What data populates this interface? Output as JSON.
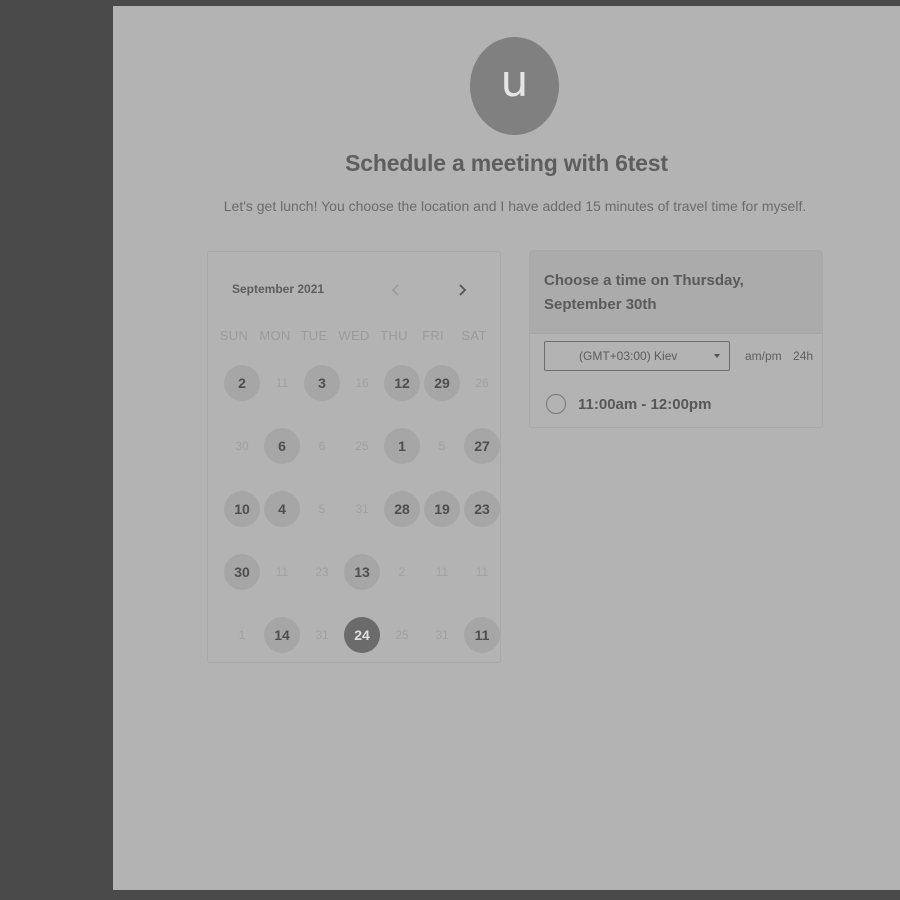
{
  "host": {
    "avatar_letter": "u",
    "title": "Schedule a meeting with 6test",
    "description": "Let's get lunch! You choose the location and I have added 15 minutes of travel time for myself."
  },
  "calendar": {
    "month_label": "September 2021",
    "prev_icon": "chevron-left-icon",
    "next_icon": "chevron-right-icon",
    "weekdays": [
      "SUN",
      "MON",
      "TUE",
      "WED",
      "THU",
      "FRI",
      "SAT"
    ],
    "weeks": [
      [
        {
          "d": "2",
          "s": "avail"
        },
        {
          "d": "11",
          "s": "unavail"
        },
        {
          "d": "3",
          "s": "avail"
        },
        {
          "d": "16",
          "s": "unavail"
        },
        {
          "d": "12",
          "s": "avail"
        },
        {
          "d": "29",
          "s": "avail"
        },
        {
          "d": "26",
          "s": "unavail"
        }
      ],
      [
        {
          "d": "30",
          "s": "unavail"
        },
        {
          "d": "6",
          "s": "avail"
        },
        {
          "d": "6",
          "s": "unavail"
        },
        {
          "d": "25",
          "s": "unavail"
        },
        {
          "d": "1",
          "s": "avail"
        },
        {
          "d": "5",
          "s": "unavail"
        },
        {
          "d": "27",
          "s": "avail"
        }
      ],
      [
        {
          "d": "10",
          "s": "avail"
        },
        {
          "d": "4",
          "s": "avail"
        },
        {
          "d": "5",
          "s": "unavail"
        },
        {
          "d": "31",
          "s": "unavail"
        },
        {
          "d": "28",
          "s": "avail"
        },
        {
          "d": "19",
          "s": "avail"
        },
        {
          "d": "23",
          "s": "avail"
        }
      ],
      [
        {
          "d": "30",
          "s": "avail"
        },
        {
          "d": "11",
          "s": "unavail"
        },
        {
          "d": "23",
          "s": "unavail"
        },
        {
          "d": "13",
          "s": "avail"
        },
        {
          "d": "2",
          "s": "unavail"
        },
        {
          "d": "11",
          "s": "unavail"
        },
        {
          "d": "11",
          "s": "unavail"
        }
      ],
      [
        {
          "d": "1",
          "s": "unavail"
        },
        {
          "d": "14",
          "s": "avail"
        },
        {
          "d": "31",
          "s": "unavail"
        },
        {
          "d": "24",
          "s": "selected"
        },
        {
          "d": "25",
          "s": "unavail"
        },
        {
          "d": "31",
          "s": "unavail"
        },
        {
          "d": "11",
          "s": "avail"
        }
      ]
    ]
  },
  "times": {
    "heading": "Choose a time on Thursday, September 30th",
    "timezone": "(GMT+03:00) Kiev",
    "format_ampm": "am/pm",
    "format_24h": "24h",
    "slots": [
      "11:00am - 12:00pm"
    ]
  },
  "colors": {
    "backdrop": "#4a4a4a",
    "page": "#b3b3b3",
    "available_day": "#a6a6a6",
    "selected_day": "#6b6b6b"
  }
}
